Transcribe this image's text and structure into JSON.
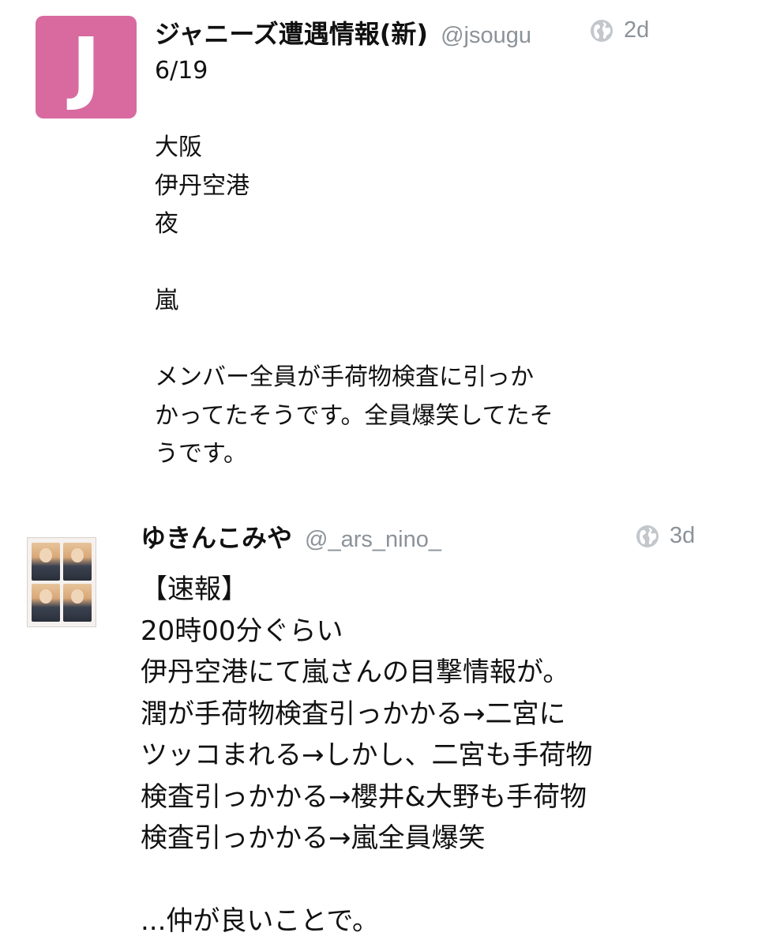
{
  "posts": [
    {
      "avatar_letter": "J",
      "avatar_color": "#d96aa0",
      "display_name": "ジャニーズ遭遇情報(新)",
      "handle": "@jsougu",
      "visibility_icon": "globe-icon",
      "timestamp": "2d",
      "body": "6/19\n\n大阪\n伊丹空港\n夜\n\n嵐\n\nメンバー全員が手荷物検査に引っか\nかってたそうです。全員爆笑してたそ\nうです。"
    },
    {
      "avatar_type": "photo-collage",
      "display_name": "ゆきんこみや",
      "handle": "@_ars_nino_",
      "visibility_icon": "globe-icon",
      "timestamp": "3d",
      "body": "【速報】\n20時00分ぐらい\n伊丹空港にて嵐さんの目撃情報が。\n潤が手荷物検査引っかかる→二宮に\nツッコまれる→しかし、二宮も手荷物\n検査引っかかる→櫻井&大野も手荷物\n検査引っかかる→嵐全員爆笑\n\n...仲が良いことで。"
    }
  ],
  "colors": {
    "meta_gray": "#8b9298",
    "text": "#111111",
    "background": "#ffffff"
  }
}
